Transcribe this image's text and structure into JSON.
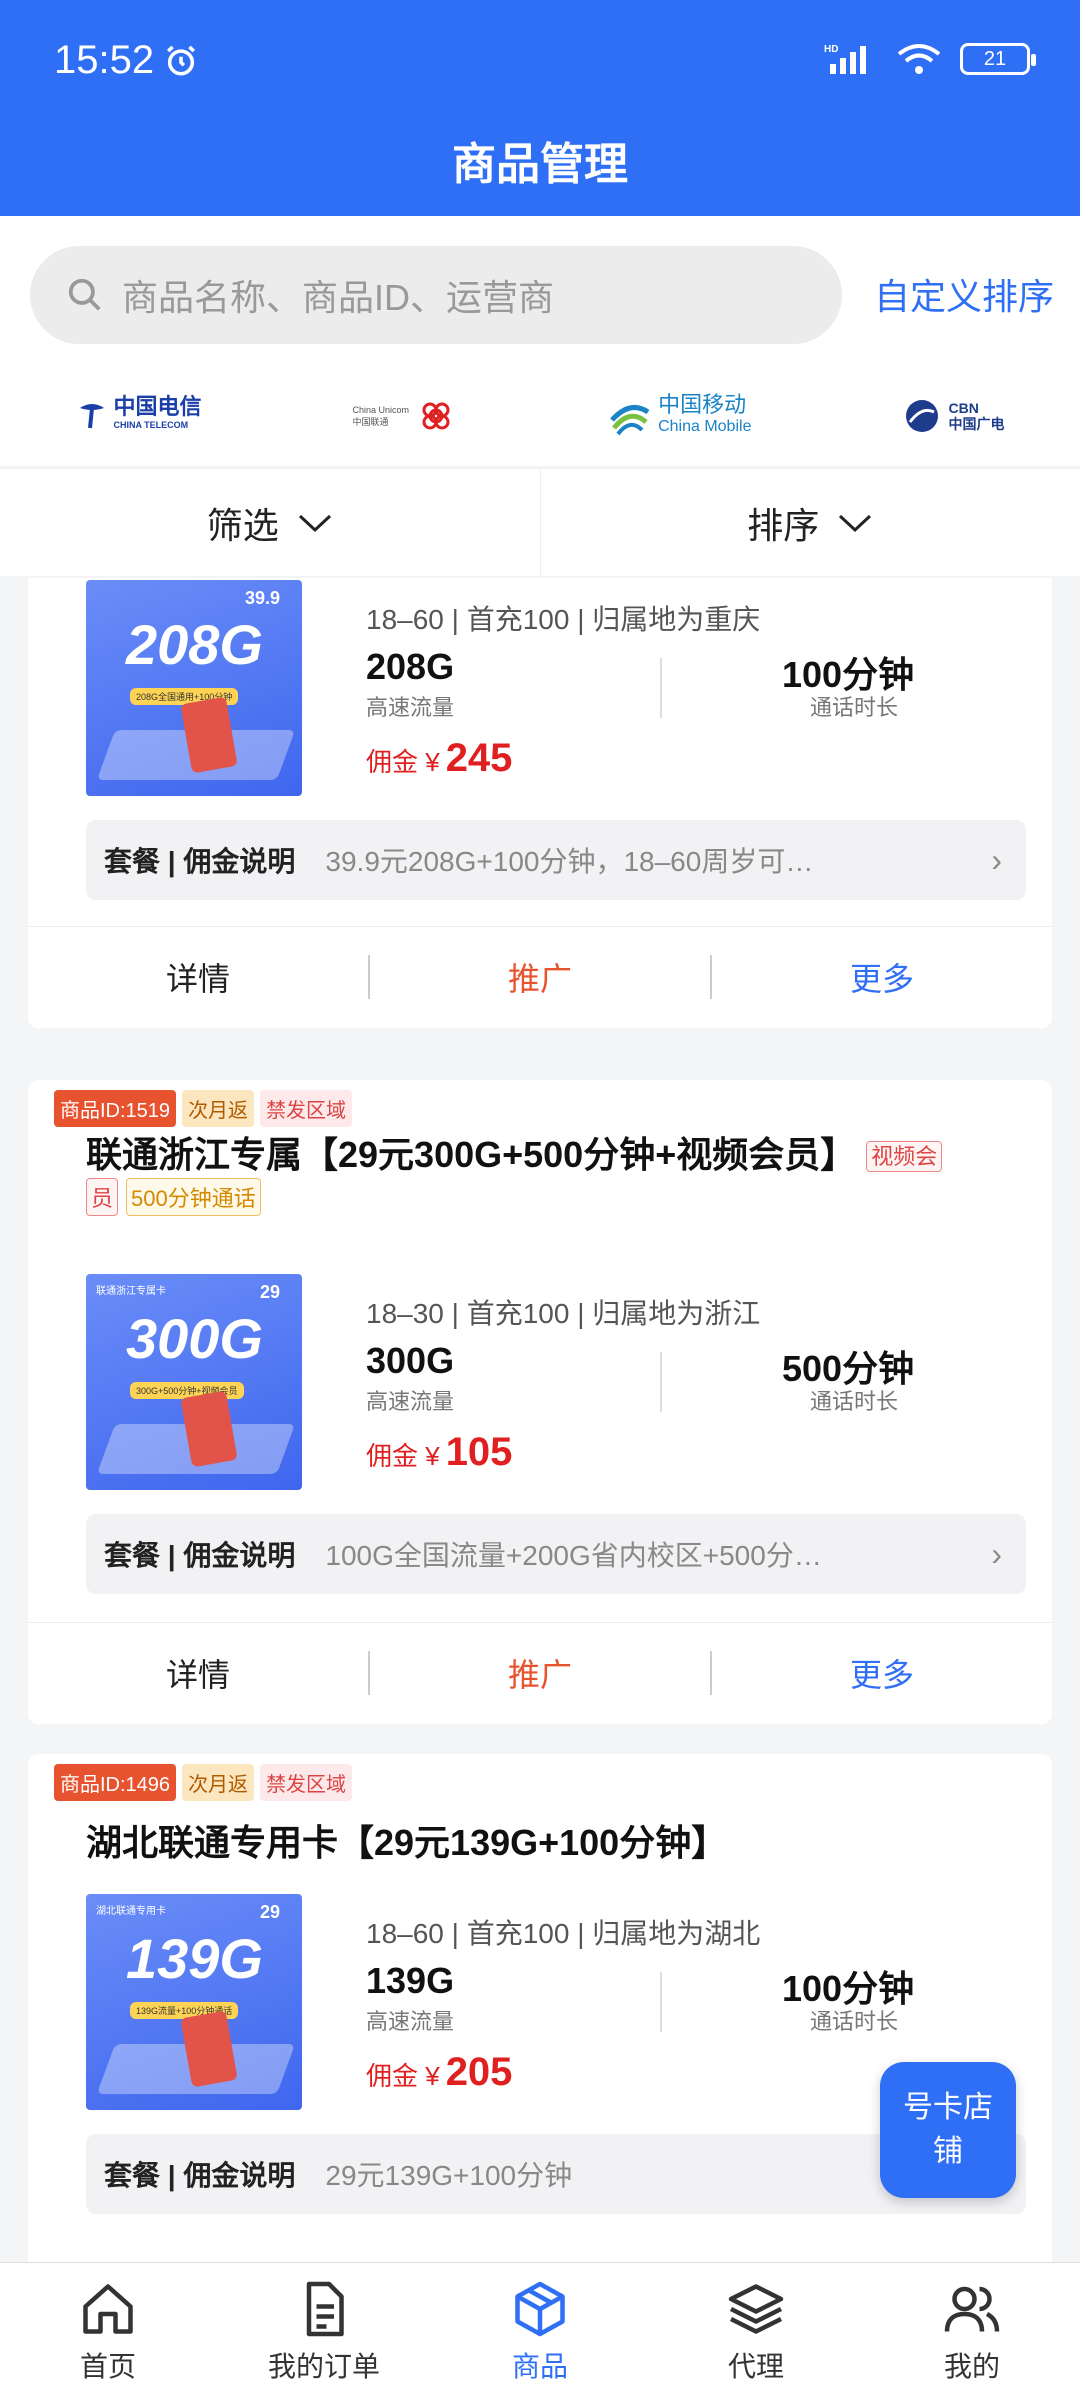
{
  "status": {
    "time": "15:52",
    "battery": "21"
  },
  "header": {
    "title": "商品管理"
  },
  "search": {
    "placeholder": "商品名称、商品ID、运营商",
    "custom_sort": "自定义排序"
  },
  "carriers": [
    {
      "name": "中国电信",
      "sub": "CHINA TELECOM",
      "color": "#1b3fa8"
    },
    {
      "name": "中国联通",
      "sub": "China Unicom",
      "color": "#e02020"
    },
    {
      "name": "中国移动",
      "sub": "China Mobile",
      "color": "#1a84c7"
    },
    {
      "name": "中国广电",
      "sub": "CBN",
      "color": "#1e3c8c"
    }
  ],
  "filters": {
    "filter": "筛选",
    "sort": "排序"
  },
  "products": [
    {
      "thumb": {
        "big": "208G",
        "price": "39.9",
        "strip": "208G全国通用+100分钟"
      },
      "spec": "18–60 | 首充100 | 归属地为重庆",
      "data": "208G",
      "data_label": "高速流量",
      "minutes": "100分钟",
      "minutes_label": "通话时长",
      "commission_label": "佣金 ¥",
      "commission": "245",
      "package_label": "套餐 | 佣金说明",
      "package_text": "39.9元208G+100分钟，18–60周岁可…",
      "actions": {
        "detail": "详情",
        "promote": "推广",
        "more": "更多"
      }
    },
    {
      "tags": {
        "id": "商品ID:1519",
        "month": "次月返",
        "ban": "禁发区域"
      },
      "title": "联通浙江专属【29元300G+500分钟+视频会员】",
      "title_tag_1a": "视频会",
      "title_tag_1b": "员",
      "title_tag_2": "500分钟通话",
      "thumb": {
        "big": "300G",
        "price": "29",
        "strip": "300G+500分钟+视频会员"
      },
      "spec": "18–30 | 首充100 | 归属地为浙江",
      "data": "300G",
      "data_label": "高速流量",
      "minutes": "500分钟",
      "minutes_label": "通话时长",
      "commission_label": "佣金 ¥",
      "commission": "105",
      "package_label": "套餐 | 佣金说明",
      "package_text": "100G全国流量+200G省内校区+500分…",
      "actions": {
        "detail": "详情",
        "promote": "推广",
        "more": "更多"
      }
    },
    {
      "tags": {
        "id": "商品ID:1496",
        "month": "次月返",
        "ban": "禁发区域"
      },
      "title": "湖北联通专用卡【29元139G+100分钟】",
      "thumb": {
        "big": "139G",
        "price": "29",
        "strip": "139G流量+100分钟通话"
      },
      "spec": "18–60 | 首充100 | 归属地为湖北",
      "data": "139G",
      "data_label": "高速流量",
      "minutes": "100分钟",
      "minutes_label": "通话时长",
      "commission_label": "佣金 ¥",
      "commission": "205",
      "package_label": "套餐 | 佣金说明",
      "package_text": "29元139G+100分钟"
    }
  ],
  "float_button": {
    "line1": "号卡店",
    "line2": "铺"
  },
  "tabbar": [
    {
      "label": "首页",
      "icon": "home-icon"
    },
    {
      "label": "我的订单",
      "icon": "document-icon"
    },
    {
      "label": "商品",
      "icon": "box-icon",
      "active": true
    },
    {
      "label": "代理",
      "icon": "layers-icon"
    },
    {
      "label": "我的",
      "icon": "users-icon"
    }
  ],
  "colors": {
    "primary": "#2e6ff6",
    "commission": "#e02020",
    "promote": "#e8532f"
  }
}
